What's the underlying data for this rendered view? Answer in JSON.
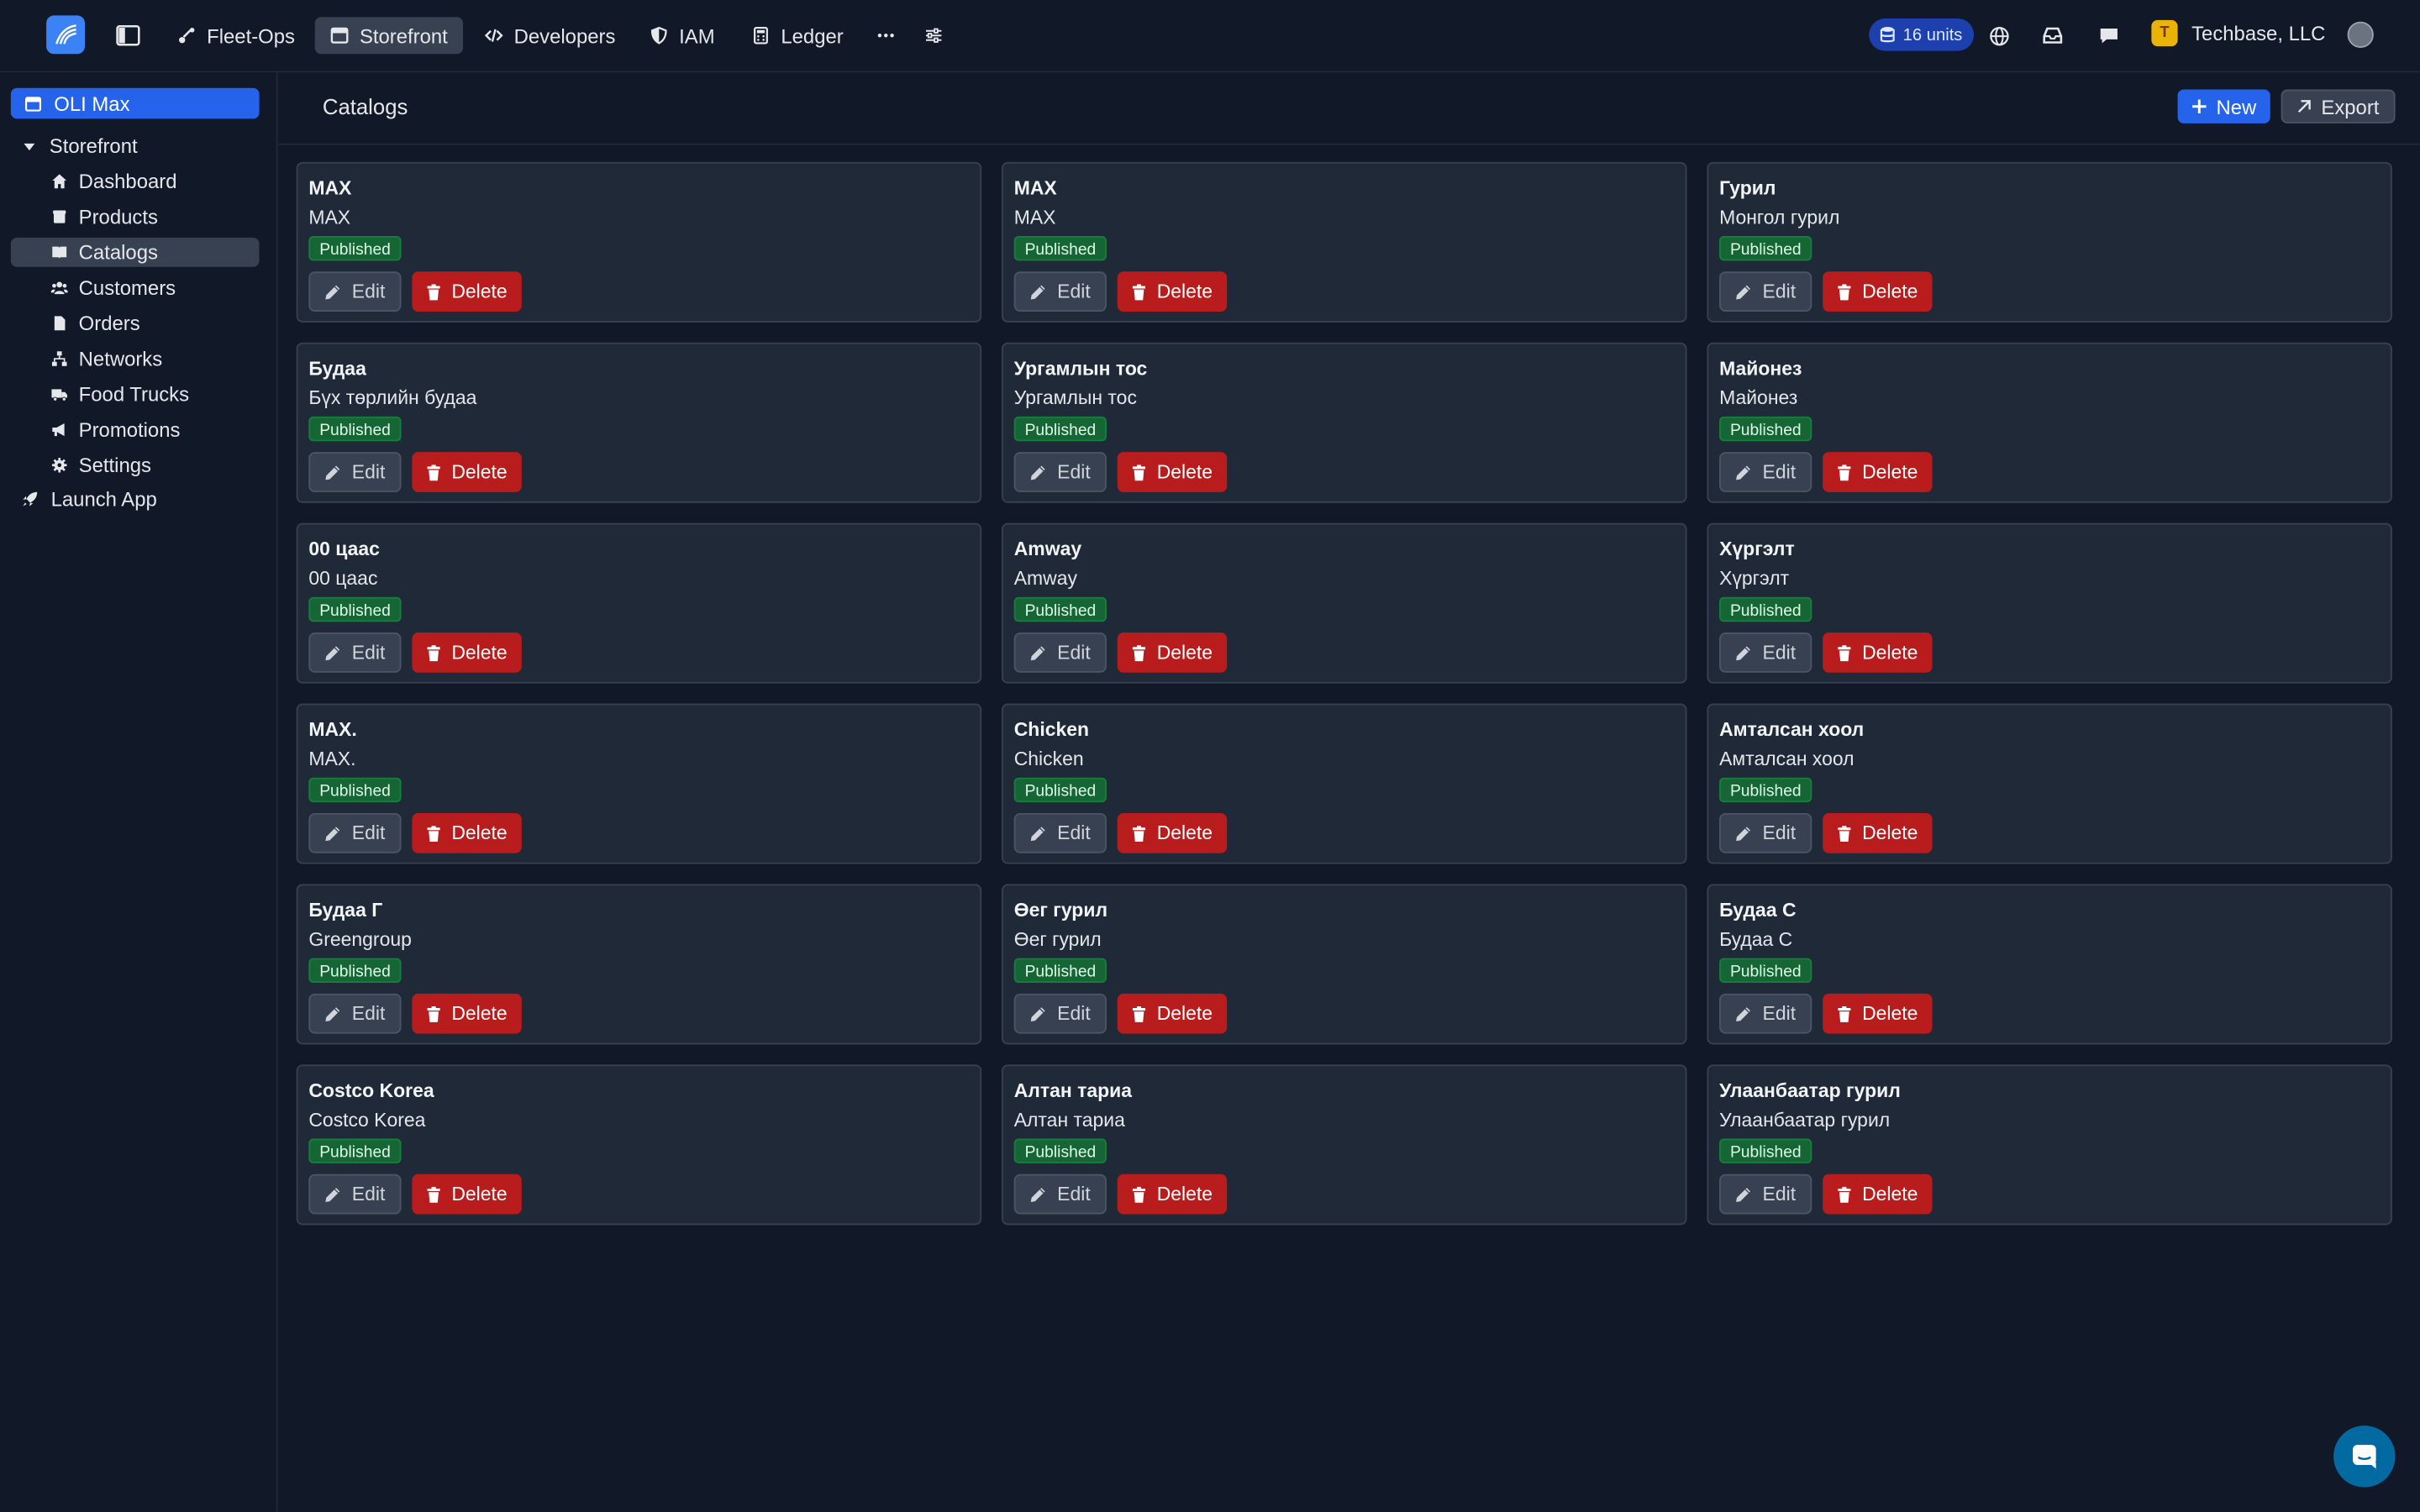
{
  "topbar": {
    "nav": [
      {
        "label": "Fleet-Ops",
        "icon": "route-icon"
      },
      {
        "label": "Storefront",
        "icon": "store-icon"
      },
      {
        "label": "Developers",
        "icon": "code-icon"
      },
      {
        "label": "IAM",
        "icon": "shield-icon"
      },
      {
        "label": "Ledger",
        "icon": "calculator-icon"
      }
    ],
    "units": "16 units",
    "org_initial": "T",
    "org_name": "Techbase, LLC"
  },
  "sidebar": {
    "store": "OLI Max",
    "section": "Storefront",
    "items": [
      {
        "label": "Dashboard",
        "icon": "home-icon"
      },
      {
        "label": "Products",
        "icon": "box-icon"
      },
      {
        "label": "Catalogs",
        "icon": "book-icon"
      },
      {
        "label": "Customers",
        "icon": "users-icon"
      },
      {
        "label": "Orders",
        "icon": "file-icon"
      },
      {
        "label": "Networks",
        "icon": "network-icon"
      },
      {
        "label": "Food Trucks",
        "icon": "truck-icon"
      },
      {
        "label": "Promotions",
        "icon": "megaphone-icon"
      },
      {
        "label": "Settings",
        "icon": "gear-icon"
      }
    ],
    "launch": "Launch App"
  },
  "header": {
    "title": "Catalogs",
    "new_label": "New",
    "export_label": "Export"
  },
  "labels": {
    "status": "Published",
    "edit": "Edit",
    "delete": "Delete"
  },
  "catalogs": [
    {
      "title": "MAX",
      "subtitle": "MAX"
    },
    {
      "title": "MAX",
      "subtitle": "MAX"
    },
    {
      "title": "Гурил",
      "subtitle": "Монгол гурил"
    },
    {
      "title": "Будаа",
      "subtitle": "Бүх төрлийн будаа"
    },
    {
      "title": "Ургамлын тос",
      "subtitle": "Ургамлын тос"
    },
    {
      "title": "Майонез",
      "subtitle": "Майонез"
    },
    {
      "title": "00 цаас",
      "subtitle": "00 цаас"
    },
    {
      "title": "Amway",
      "subtitle": "Amway"
    },
    {
      "title": "Хүргэлт",
      "subtitle": "Хүргэлт"
    },
    {
      "title": "MAX.",
      "subtitle": "MAX."
    },
    {
      "title": "Chicken",
      "subtitle": "Chicken"
    },
    {
      "title": "Амталсан хоол",
      "subtitle": "Амталсан хоол"
    },
    {
      "title": "Будаа Г",
      "subtitle": "Greengroup"
    },
    {
      "title": "Өег гурил",
      "subtitle": "Өег гурил"
    },
    {
      "title": "Будаа С",
      "subtitle": "Будаа С"
    },
    {
      "title": "Costco Korea",
      "subtitle": "Costco Korea"
    },
    {
      "title": "Алтан тариа",
      "subtitle": "Алтан тариа"
    },
    {
      "title": "Улаанбаатар гурил",
      "subtitle": "Улаанбаатар гурил"
    }
  ]
}
